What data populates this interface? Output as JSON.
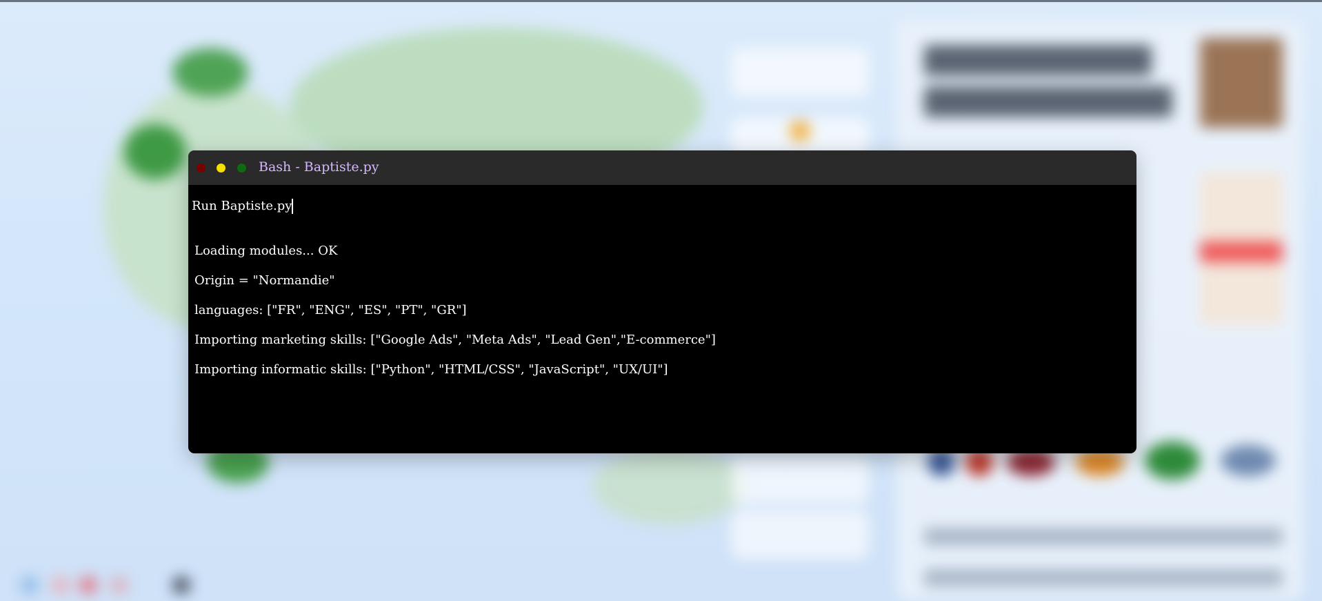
{
  "window": {
    "title": "Bash - Baptiste.py",
    "controls": {
      "close_color": "#7a0000",
      "minimize_color": "#f5e000",
      "maximize_color": "#0f6b0f"
    }
  },
  "terminal": {
    "command": "Run Baptiste.py",
    "output": [
      "Loading modules... OK",
      "Origin = \"Normandie\"",
      "languages: [\"FR\", \"ENG\", \"ES\", \"PT\", \"GR\"]",
      "Importing marketing skills: [\"Google Ads\", \"Meta Ads\", \"Lead Gen\",\"E-commerce\"]",
      "Importing informatic skills: [\"Python\", \"HTML/CSS\", \"JavaScript\", \"UX/UI\"]"
    ]
  },
  "colors": {
    "terminal_bg": "#000000",
    "titlebar_bg": "#2a2a2a",
    "title_text": "#d5b8ff",
    "terminal_text": "#ffffff"
  }
}
